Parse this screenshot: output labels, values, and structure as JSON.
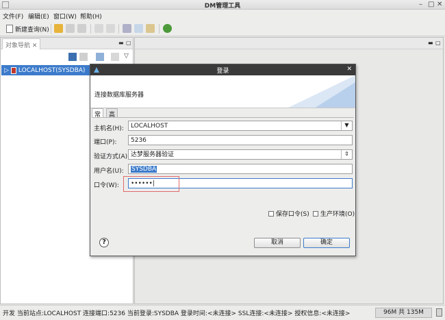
{
  "window": {
    "title": "DM管理工具",
    "minimize": "–",
    "maximize": "□",
    "close": "✕"
  },
  "menu": {
    "file": "文件(F)",
    "edit": "编辑(E)",
    "window": "窗口(W)",
    "help": "帮助(H)"
  },
  "toolbar": {
    "new_query": "新建查询(N)"
  },
  "nav": {
    "tab_label": "对象导航 ✕",
    "tree_item": "LOCALHOST(SYSDBA)"
  },
  "dialog": {
    "title": "登录",
    "subtitle": "连接数据库服务器",
    "tabs": [
      "常规",
      "高级"
    ],
    "fields": {
      "host_label": "主机名(H):",
      "host_value": "LOCALHOST",
      "port_label": "端口(P):",
      "port_value": "5236",
      "auth_label": "验证方式(A):",
      "auth_value": "达梦服务器验证",
      "user_label": "用户名(U):",
      "user_value": "SYSDBA",
      "pwd_label": "口令(W):",
      "pwd_value": "••••••"
    },
    "save_pwd": "保存口令(S)",
    "prod_env": "生产环境(O)",
    "cancel": "取消",
    "ok": "确定"
  },
  "status": {
    "text": "开发  当前站点:LOCALHOST   连接端口:5236   当前登录:SYSDBA   登录时间:<未连接>   SSL连接:<未连接>   授权信息:<未连接>",
    "memory": "96M 共 135M"
  }
}
